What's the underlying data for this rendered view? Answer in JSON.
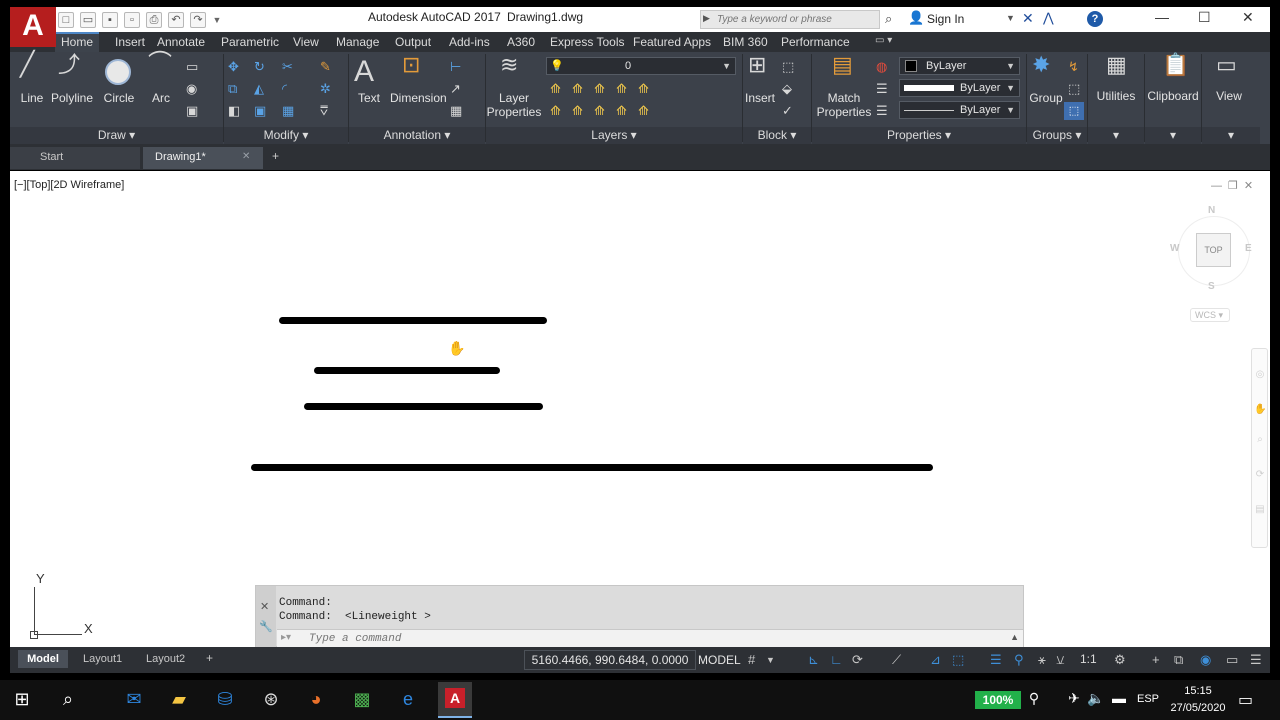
{
  "window": {
    "logo_letter": "A",
    "app_title": "Autodesk AutoCAD 2017",
    "doc_title": "Drawing1.dwg",
    "search_placeholder": "Type a keyword or phrase",
    "sign_in": "Sign In"
  },
  "ribbon_tabs": [
    "Home",
    "Insert",
    "Annotate",
    "Parametric",
    "View",
    "Manage",
    "Output",
    "Add-ins",
    "A360",
    "Express Tools",
    "Featured Apps",
    "BIM 360",
    "Performance"
  ],
  "ribbon": {
    "draw": {
      "title": "Draw",
      "tools": [
        "Line",
        "Polyline",
        "Circle",
        "Arc"
      ]
    },
    "modify": {
      "title": "Modify"
    },
    "annotation": {
      "title": "Annotation",
      "tools": [
        "Text",
        "Dimension"
      ]
    },
    "layers": {
      "title": "Layers",
      "tool_line1": "Layer",
      "tool_line2": "Properties",
      "current_layer": "0"
    },
    "block": {
      "title": "Block",
      "tool": "Insert"
    },
    "properties": {
      "title": "Properties",
      "match_line1": "Match",
      "match_line2": "Properties",
      "color": "ByLayer",
      "lineweight": "ByLayer",
      "linetype": "ByLayer"
    },
    "groups": {
      "title": "Groups",
      "tool": "Group"
    },
    "utilities": "Utilities",
    "clipboard": "Clipboard",
    "view": "View"
  },
  "file_tabs": {
    "start": "Start",
    "active": "Drawing1*"
  },
  "viewport": {
    "label": "[−][Top][2D Wireframe]",
    "viewcube": {
      "top": "TOP",
      "n": "N",
      "s": "S",
      "w": "W",
      "e": "E",
      "wcs": "WCS"
    }
  },
  "ucs": {
    "x": "X",
    "y": "Y"
  },
  "command_line": {
    "history": [
      "Command:",
      "Command:  <Lineweight >"
    ],
    "placeholder": "Type a command"
  },
  "statusbar": {
    "tabs": [
      "Model",
      "Layout1",
      "Layout2"
    ],
    "coords": "5160.4466, 990.6484, 0.0000",
    "mode": "MODEL",
    "scale": "1:1"
  },
  "taskbar": {
    "battery": "100%",
    "lang": "ESP",
    "time": "15:15",
    "date": "27/05/2020"
  },
  "colors": {
    "accent_blue": "#4d87c7",
    "autocad_red": "#b51e1e",
    "ribbon_bg": "#3c414a",
    "canvas_bg": "#ffffff",
    "battery_green": "#22b04a"
  }
}
